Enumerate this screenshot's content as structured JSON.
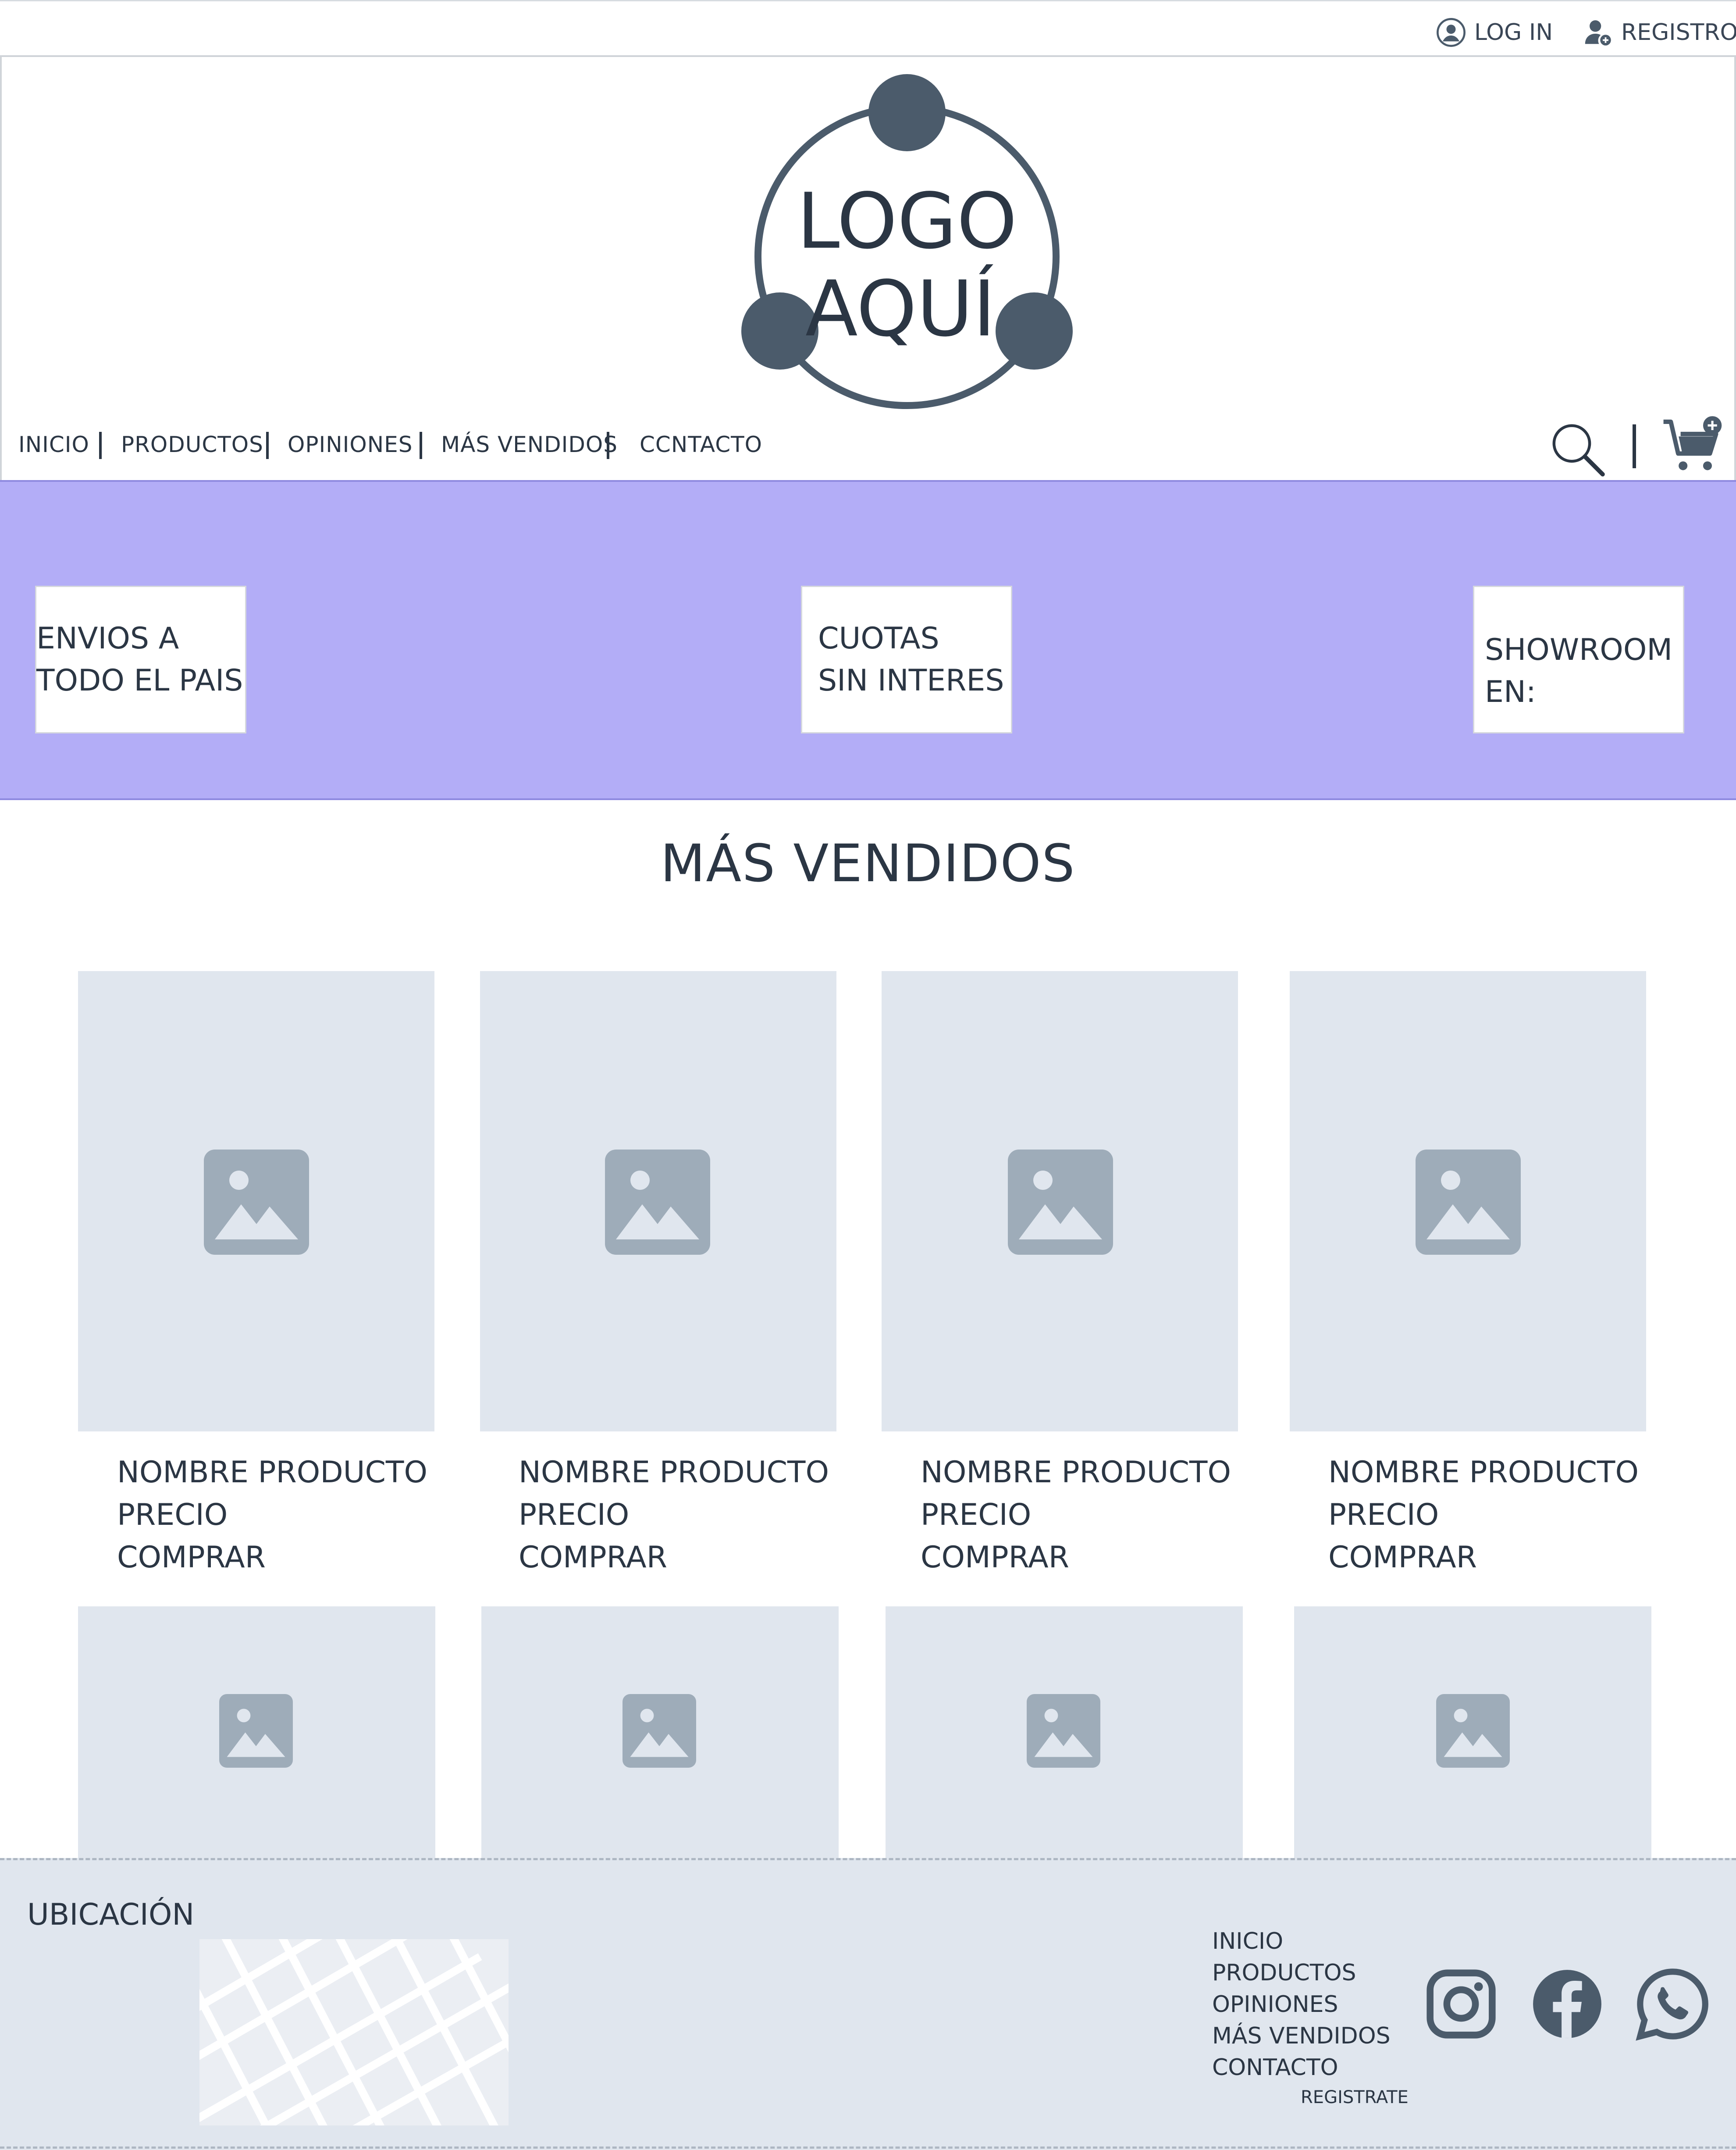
{
  "topbar": {
    "login": {
      "label": "LOG IN",
      "icon": "user-circle-icon"
    },
    "register": {
      "label": "REGISTRO",
      "icon": "add-user-icon"
    }
  },
  "header": {
    "logo": {
      "line1": "LOGO",
      "line2": "AQUÍ"
    },
    "nav": [
      "INICIO",
      "PRODUCTOS",
      "OPINIONES",
      "MÁS VENDIDOS",
      "CCNTACTO"
    ],
    "icons": [
      "search-icon",
      "cart-add-icon"
    ]
  },
  "banner": {
    "features": [
      {
        "line1": "ENVIOS A",
        "line2": "TODO EL PAIS"
      },
      {
        "line1": "CUOTAS",
        "line2": "SIN INTERES"
      },
      {
        "line1": "SHOWROOM",
        "line2": "EN:"
      }
    ]
  },
  "best_sellers": {
    "title": "MÁS VENDIDOS",
    "products": [
      {
        "name": "NOMBRE PRODUCTO",
        "price": "PRECIO",
        "buy": "COMPRAR"
      },
      {
        "name": "NOMBRE PRODUCTO",
        "price": "PRECIO",
        "buy": "COMPRAR"
      },
      {
        "name": "NOMBRE PRODUCTO",
        "price": "PRECIO",
        "buy": "COMPRAR"
      },
      {
        "name": "NOMBRE PRODUCTO",
        "price": "PRECIO",
        "buy": "COMPRAR"
      }
    ]
  },
  "footer": {
    "location_label": "UBICACIÓN",
    "links": [
      "INICIO",
      "PRODUCTOS",
      "OPINIONES",
      "MÁS VENDIDOS",
      "CONTACTO"
    ],
    "register": "REGISTRATE",
    "social": [
      "instagram-icon",
      "facebook-icon",
      "whatsapp-icon"
    ]
  },
  "colors": {
    "primary": "#4b5b6b",
    "banner": "#b3adf7",
    "placeholder": "#e0e6ee",
    "placeholder_icon": "#9eacb9",
    "text": "#2b3644"
  }
}
